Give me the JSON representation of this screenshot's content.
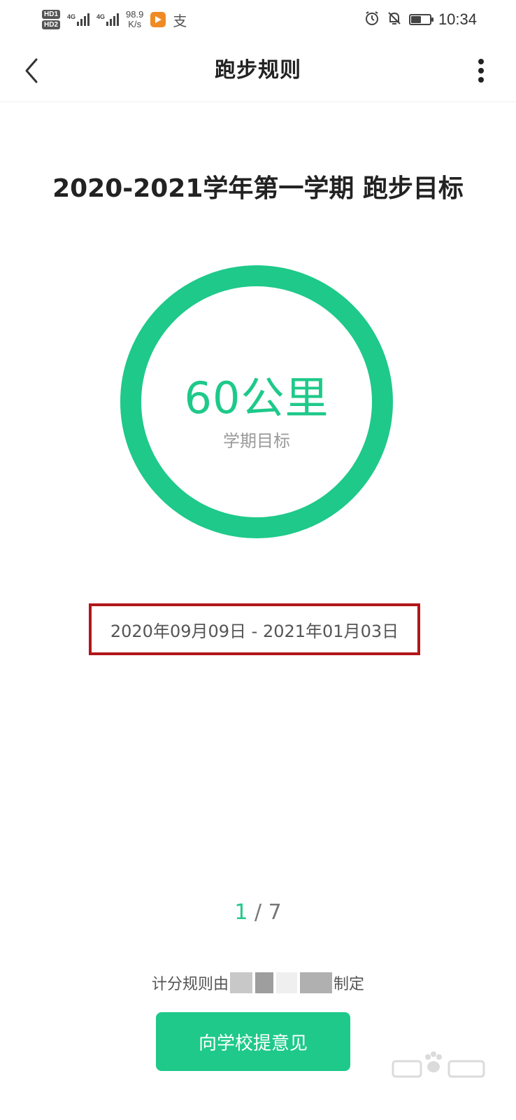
{
  "status_bar": {
    "hd1": "HD",
    "hd1_sub": "1",
    "hd2": "HD",
    "hd2_sub": "2",
    "net1": "4G",
    "net2": "4G",
    "speed_value": "98.9",
    "speed_unit": "K/s",
    "alipay_glyph": "支",
    "time": "10:34",
    "battery_level": 0.6,
    "icons": [
      "alarm-icon",
      "bell-off-icon",
      "battery-icon",
      "video-app-icon"
    ]
  },
  "nav": {
    "title": "跑步规则",
    "back_icon": "chevron-left-icon",
    "more_icon": "more-vertical-icon"
  },
  "goal": {
    "heading": "2020-2021学年第一学期 跑步目标",
    "value": "60公里",
    "caption": "学期目标",
    "ring_color": "#1ec98a"
  },
  "period": {
    "date_range": "2020年09月09日 - 2021年01月03日",
    "highlight_color": "#b2161c"
  },
  "pager": {
    "current": "1",
    "separator": " / ",
    "total": "7"
  },
  "credit": {
    "prefix": "计分规则由",
    "suffix": "制定"
  },
  "actions": {
    "suggest_label": "向学校提意见"
  },
  "colors": {
    "accent": "#1ec98a",
    "text": "#222222",
    "muted": "#9a9a9a"
  }
}
